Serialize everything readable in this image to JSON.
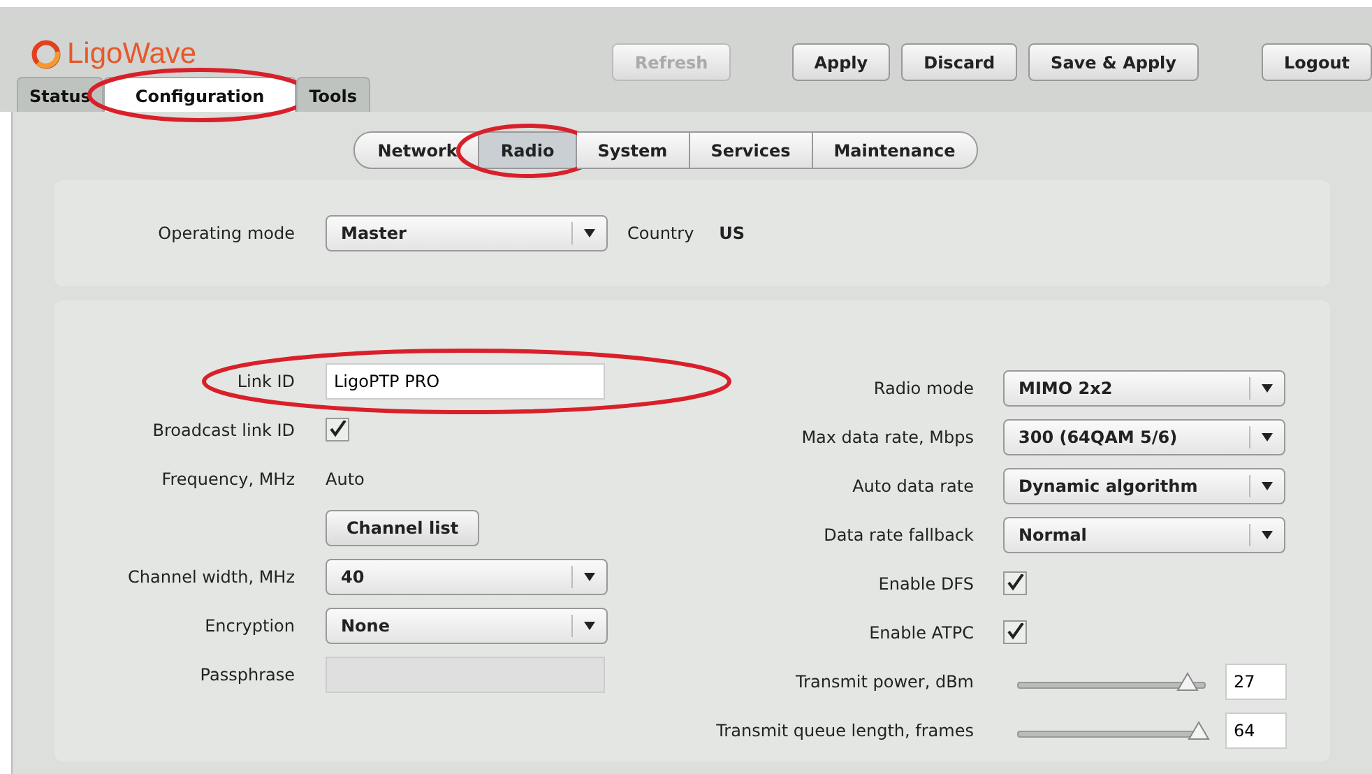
{
  "logo": {
    "text": "LigoWave"
  },
  "tabs": [
    {
      "label": "Status",
      "selected": false,
      "highlighted": false
    },
    {
      "label": "Configuration",
      "selected": true,
      "highlighted": true
    },
    {
      "label": "Tools",
      "selected": false,
      "highlighted": false
    }
  ],
  "actions": [
    {
      "label": "Refresh",
      "disabled": true
    },
    {
      "label": "Apply",
      "disabled": false
    },
    {
      "label": "Discard",
      "disabled": false
    },
    {
      "label": "Save & Apply",
      "disabled": false
    }
  ],
  "logout": {
    "label": "Logout"
  },
  "subtabs": [
    {
      "label": "Network",
      "selected": false,
      "highlighted": false
    },
    {
      "label": "Radio",
      "selected": true,
      "highlighted": true
    },
    {
      "label": "System",
      "selected": false,
      "highlighted": false
    },
    {
      "label": "Services",
      "selected": false,
      "highlighted": false
    },
    {
      "label": "Maintenance",
      "selected": false,
      "highlighted": false
    }
  ],
  "mode_row": {
    "label": "Operating mode",
    "value": "Master",
    "country_label": "Country",
    "country": "US"
  },
  "left_fields": [
    {
      "kind": "text",
      "label": "Link ID",
      "value": "LigoPTP PRO",
      "highlighted": true
    },
    {
      "kind": "checkbox",
      "label": "Broadcast link ID",
      "checked": true
    },
    {
      "kind": "static",
      "label": "Frequency, MHz",
      "value": "Auto"
    },
    {
      "kind": "button",
      "value": "Channel list"
    },
    {
      "kind": "select",
      "label": "Channel width, MHz",
      "value": "40"
    },
    {
      "kind": "select",
      "label": "Encryption",
      "value": "None"
    },
    {
      "kind": "disabled_text",
      "label": "Passphrase"
    }
  ],
  "right_fields": [
    {
      "kind": "select",
      "label": "Radio mode",
      "value": "MIMO 2x2"
    },
    {
      "kind": "select",
      "label": "Max data rate, Mbps",
      "value": "300 (64QAM 5/6)"
    },
    {
      "kind": "select",
      "label": "Auto data rate",
      "value": "Dynamic algorithm"
    },
    {
      "kind": "select",
      "label": "Data rate fallback",
      "value": "Normal"
    },
    {
      "kind": "checkbox",
      "label": "Enable DFS",
      "checked": true
    },
    {
      "kind": "checkbox",
      "label": "Enable ATPC",
      "checked": true
    },
    {
      "kind": "slider",
      "label": "Transmit power, dBm",
      "level": 0.9,
      "value": "27"
    },
    {
      "kind": "slider",
      "label": "Transmit queue length, frames",
      "level": 0.96,
      "value": "64"
    }
  ]
}
